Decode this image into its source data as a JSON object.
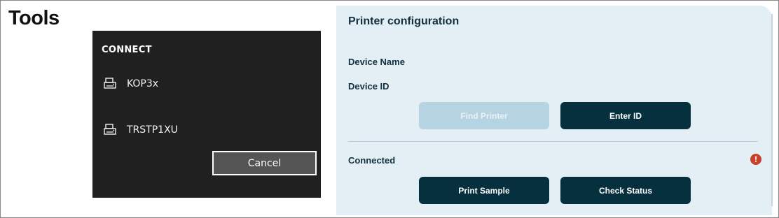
{
  "page": {
    "title": "Tools"
  },
  "connect_panel": {
    "heading": "CONNECT",
    "devices": [
      {
        "name": "KOP3x",
        "icon": "printer-icon"
      },
      {
        "name": "TRSTP1XU",
        "icon": "printer-icon"
      }
    ],
    "cancel_label": "Cancel"
  },
  "printer_config": {
    "title": "Printer configuration",
    "device_name_label": "Device Name",
    "device_id_label": "Device ID",
    "find_printer_label": "Find Printer",
    "enter_id_label": "Enter ID",
    "connected_label": "Connected",
    "connection_status_icon": "alert-icon",
    "print_sample_label": "Print Sample",
    "check_status_label": "Check Status"
  },
  "colors": {
    "dark_panel": "#202020",
    "config_background": "#e4eff5",
    "primary_button": "#07303f",
    "disabled_button": "#b5d3e0",
    "alert": "#c8412b"
  }
}
